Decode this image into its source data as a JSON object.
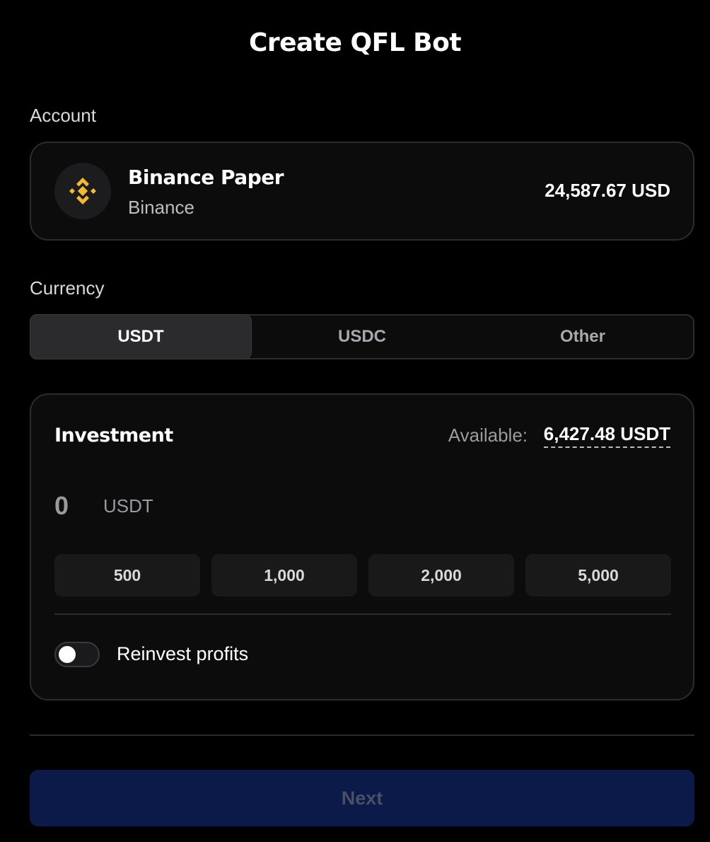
{
  "header": {
    "title": "Create QFL Bot"
  },
  "account": {
    "section_label": "Account",
    "name": "Binance Paper",
    "exchange": "Binance",
    "balance": "24,587.67 USD",
    "logo_icon": "binance-logo-icon",
    "logo_color": "#F3BA2F"
  },
  "currency": {
    "section_label": "Currency",
    "tabs": [
      {
        "label": "USDT",
        "selected": true
      },
      {
        "label": "USDC",
        "selected": false
      },
      {
        "label": "Other",
        "selected": false
      }
    ]
  },
  "investment": {
    "title": "Investment",
    "available_label": "Available:",
    "available_value": "6,427.48 USDT",
    "amount_value": "0",
    "amount_unit": "USDT",
    "presets": [
      "500",
      "1,000",
      "2,000",
      "5,000"
    ],
    "reinvest": {
      "label": "Reinvest profits",
      "enabled": false
    }
  },
  "footer": {
    "next_label": "Next",
    "next_color": "#0C1A4A"
  }
}
